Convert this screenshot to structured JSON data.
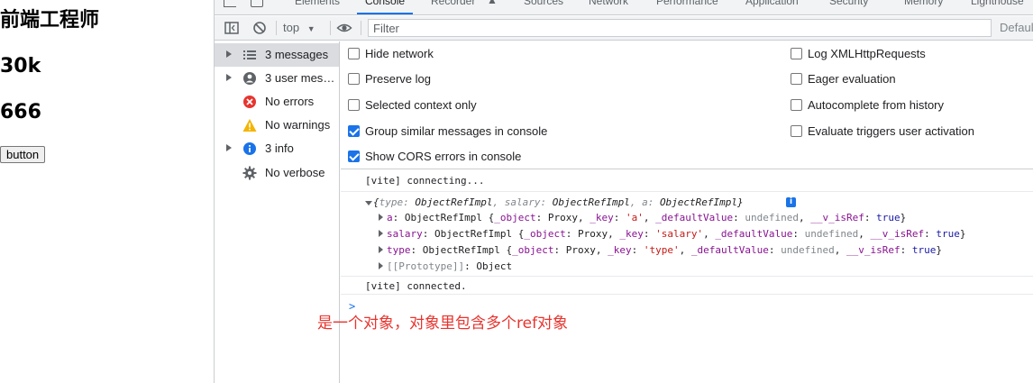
{
  "page": {
    "heading1": "前端工程师",
    "heading2": "30k",
    "heading3": "666",
    "button_label": "button"
  },
  "devtools": {
    "tabs": [
      "Elements",
      "Console",
      "Recorder",
      "Sources",
      "Network",
      "Performance",
      "Application",
      "Security",
      "Memory",
      "Lighthouse"
    ],
    "active_tab": "Console",
    "toolbar": {
      "context": "top",
      "filter_placeholder": "Filter",
      "levels": "Defaul"
    },
    "sidebar": {
      "items": [
        {
          "label": "3 messages",
          "icon": "list-icon",
          "expandable": true,
          "selected": true
        },
        {
          "label": "3 user messages",
          "icon": "user-icon",
          "expandable": true,
          "selected": false
        },
        {
          "label": "No errors",
          "icon": "error-icon",
          "expandable": false,
          "selected": false
        },
        {
          "label": "No warnings",
          "icon": "warning-icon",
          "expandable": false,
          "selected": false
        },
        {
          "label": "3 info",
          "icon": "info-icon",
          "expandable": true,
          "selected": false
        },
        {
          "label": "No verbose",
          "icon": "gear-icon",
          "expandable": false,
          "selected": false
        }
      ]
    },
    "settings": {
      "left": [
        {
          "label": "Hide network",
          "checked": false
        },
        {
          "label": "Preserve log",
          "checked": false
        },
        {
          "label": "Selected context only",
          "checked": false
        },
        {
          "label": "Group similar messages in console",
          "checked": true
        },
        {
          "label": "Show CORS errors in console",
          "checked": true
        }
      ],
      "right": [
        {
          "label": "Log XMLHttpRequests",
          "checked": false
        },
        {
          "label": "Eager evaluation",
          "checked": false
        },
        {
          "label": "Autocomplete from history",
          "checked": false
        },
        {
          "label": "Evaluate triggers user activation",
          "checked": false
        }
      ]
    },
    "console": {
      "line1": "[vite] connecting...",
      "object_summary": {
        "open": "{",
        "k1": "type",
        "v1": "ObjectRefImpl",
        "k2": "salary",
        "v2": "ObjectRefImpl",
        "k3": "a",
        "v3": "ObjectRefImpl",
        "close": "}"
      },
      "props": [
        {
          "key": "a",
          "key_str": "'a'"
        },
        {
          "key": "salary",
          "key_str": "'salary'"
        },
        {
          "key": "type",
          "key_str": "'type'"
        }
      ],
      "prop_text": {
        "class_name": "ObjectRefImpl",
        "object_label": "_object",
        "proxy": "Proxy",
        "key_label": "_key",
        "default_label": "_defaultValue",
        "undefined": "undefined",
        "isref_label": "__v_isRef",
        "true": "true"
      },
      "prototype_key": "[[Prototype]]",
      "prototype_value": "Object",
      "line_last": "[vite] connected.",
      "info_badge": "i",
      "prompt": ">"
    }
  },
  "annotation": "是一个对象，对象里包含多个ref对象",
  "colors": {
    "accent": "#1a73e8",
    "annotation": "#e8342e",
    "string": "#c41a16",
    "key": "#881391",
    "boolean": "#1a1aa6"
  }
}
